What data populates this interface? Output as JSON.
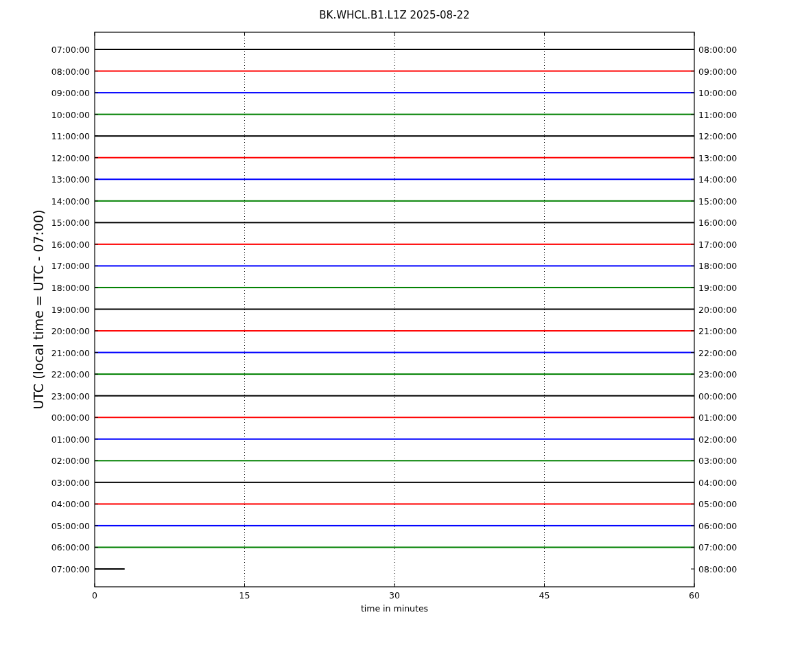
{
  "title": "BK.WHCL.B1.L1Z 2025-08-22",
  "ylabel": "UTC (local time = UTC - 07:00)",
  "xlabel": "time in minutes",
  "xticks": [
    "0",
    "15",
    "30",
    "45",
    "60"
  ],
  "rows": [
    {
      "left": "07:00:00",
      "right": "08:00:00",
      "color": "#000000",
      "kind": "full"
    },
    {
      "left": "08:00:00",
      "right": "09:00:00",
      "color": "#ff0000",
      "kind": "full"
    },
    {
      "left": "09:00:00",
      "right": "10:00:00",
      "color": "#0000ff",
      "kind": "full"
    },
    {
      "left": "10:00:00",
      "right": "11:00:00",
      "color": "#008000",
      "kind": "full"
    },
    {
      "left": "11:00:00",
      "right": "12:00:00",
      "color": "#000000",
      "kind": "full"
    },
    {
      "left": "12:00:00",
      "right": "13:00:00",
      "color": "#ff0000",
      "kind": "full"
    },
    {
      "left": "13:00:00",
      "right": "14:00:00",
      "color": "#0000ff",
      "kind": "full"
    },
    {
      "left": "14:00:00",
      "right": "15:00:00",
      "color": "#008000",
      "kind": "full"
    },
    {
      "left": "15:00:00",
      "right": "16:00:00",
      "color": "#000000",
      "kind": "full"
    },
    {
      "left": "16:00:00",
      "right": "17:00:00",
      "color": "#ff0000",
      "kind": "full"
    },
    {
      "left": "17:00:00",
      "right": "18:00:00",
      "color": "#0000ff",
      "kind": "full"
    },
    {
      "left": "18:00:00",
      "right": "19:00:00",
      "color": "#008000",
      "kind": "full"
    },
    {
      "left": "19:00:00",
      "right": "20:00:00",
      "color": "#000000",
      "kind": "full"
    },
    {
      "left": "20:00:00",
      "right": "21:00:00",
      "color": "#ff0000",
      "kind": "full"
    },
    {
      "left": "21:00:00",
      "right": "22:00:00",
      "color": "#0000ff",
      "kind": "full"
    },
    {
      "left": "22:00:00",
      "right": "23:00:00",
      "color": "#008000",
      "kind": "full"
    },
    {
      "left": "23:00:00",
      "right": "00:00:00",
      "color": "#000000",
      "kind": "full"
    },
    {
      "left": "00:00:00",
      "right": "01:00:00",
      "color": "#ff0000",
      "kind": "full"
    },
    {
      "left": "01:00:00",
      "right": "02:00:00",
      "color": "#0000ff",
      "kind": "full"
    },
    {
      "left": "02:00:00",
      "right": "03:00:00",
      "color": "#008000",
      "kind": "full"
    },
    {
      "left": "03:00:00",
      "right": "04:00:00",
      "color": "#000000",
      "kind": "full"
    },
    {
      "left": "04:00:00",
      "right": "05:00:00",
      "color": "#ff0000",
      "kind": "full"
    },
    {
      "left": "05:00:00",
      "right": "06:00:00",
      "color": "#0000ff",
      "kind": "full"
    },
    {
      "left": "06:00:00",
      "right": "07:00:00",
      "color": "#008000",
      "kind": "full"
    },
    {
      "left": "07:00:00",
      "right": "08:00:00",
      "color": "#000000",
      "kind": "partial"
    }
  ]
}
